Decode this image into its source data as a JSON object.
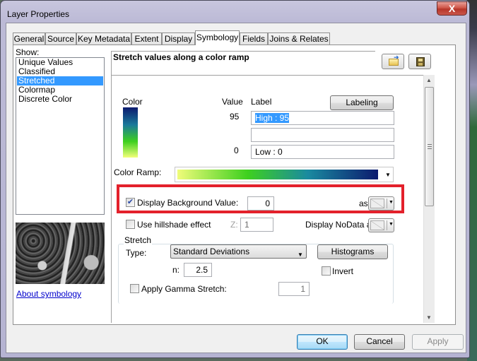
{
  "window": {
    "title": "Layer Properties",
    "close_label": "X"
  },
  "tabs": [
    {
      "label": "General"
    },
    {
      "label": "Source"
    },
    {
      "label": "Key Metadata"
    },
    {
      "label": "Extent"
    },
    {
      "label": "Display"
    },
    {
      "label": "Symbology",
      "active": true
    },
    {
      "label": "Fields"
    },
    {
      "label": "Joins & Relates"
    }
  ],
  "show": {
    "label": "Show:",
    "items": [
      {
        "label": "Unique Values"
      },
      {
        "label": "Classified"
      },
      {
        "label": "Stretched",
        "selected": true
      },
      {
        "label": "Colormap"
      },
      {
        "label": "Discrete Color"
      }
    ],
    "about_link": "About symbology"
  },
  "symbology": {
    "heading": "Stretch values along a color ramp",
    "open_icon": "open-folder-icon",
    "save_icon": "save-disk-icon",
    "columns": {
      "color": "Color",
      "value": "Value",
      "label": "Label"
    },
    "labeling_button": "Labeling",
    "high_value": "95",
    "high_label": "High : 95",
    "middle_label": "",
    "low_value": "0",
    "low_label": "Low : 0",
    "color_ramp_label": "Color Ramp:",
    "color_ramp_colors": [
      "#f0fc7a",
      "#3ed01e",
      "#1a8aa0",
      "#0c1a6e"
    ],
    "background": {
      "checked": true,
      "label": "Display Background Value:",
      "value": "0",
      "as_label": "as"
    },
    "hillshade": {
      "checked": false,
      "label": "Use hillshade effect",
      "z_label": "Z:",
      "z_value": "1"
    },
    "nodata_label": "Display NoData as",
    "stretch": {
      "group_label": "Stretch",
      "type_label": "Type:",
      "type_value": "Standard Deviations",
      "histograms_button": "Histograms",
      "n_label": "n:",
      "n_value": "2.5",
      "invert_label": "Invert",
      "invert_checked": false,
      "gamma_label": "Apply Gamma Stretch:",
      "gamma_checked": false,
      "gamma_value": "1"
    },
    "highlight_color": "#e3212b"
  },
  "footer": {
    "ok": "OK",
    "cancel": "Cancel",
    "apply": "Apply"
  }
}
